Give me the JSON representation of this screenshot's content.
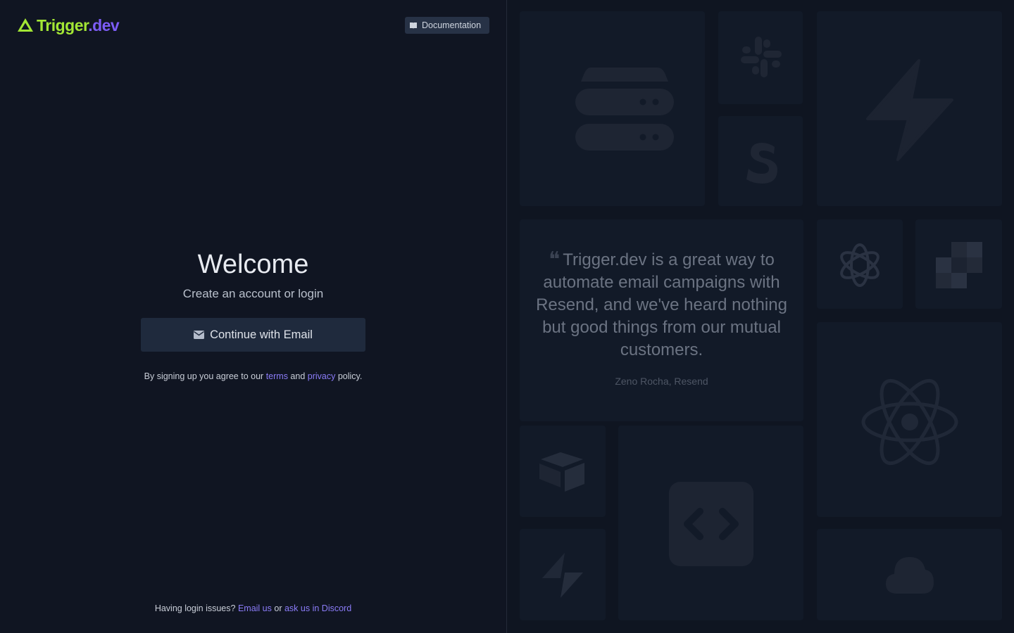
{
  "brand": {
    "name_part1": "Trigger",
    "name_part2": ".dev",
    "accent": "#a3e635",
    "accent2": "#7c5cf6"
  },
  "header": {
    "documentation_label": "Documentation",
    "documentation_icon": "book-open-icon"
  },
  "auth": {
    "title": "Welcome",
    "subtitle": "Create an account or login",
    "email_button_label": "Continue with Email",
    "email_button_icon": "envelope-icon",
    "terms_prefix": "By signing up you agree to our",
    "terms_link": "terms",
    "terms_and": "and",
    "privacy_link": "privacy",
    "terms_suffix": "policy."
  },
  "footer": {
    "prefix": "Having login issues?",
    "email_link": "Email us",
    "or": "or",
    "discord_link": "ask us in Discord"
  },
  "testimonial": {
    "quote": "Trigger.dev is a great way to automate email campaigns with Resend, and we've heard nothing but good things from our mutual customers.",
    "author": "Zeno Rocha, Resend"
  },
  "integration_tiles": [
    "database-icon",
    "slack-icon",
    "lightning-icon",
    "stripe-icon",
    "openai-icon",
    "pixel-logo-icon",
    "react-icon",
    "airtable-icon",
    "supabase-icon",
    "code-icon",
    "cloud-icon"
  ]
}
